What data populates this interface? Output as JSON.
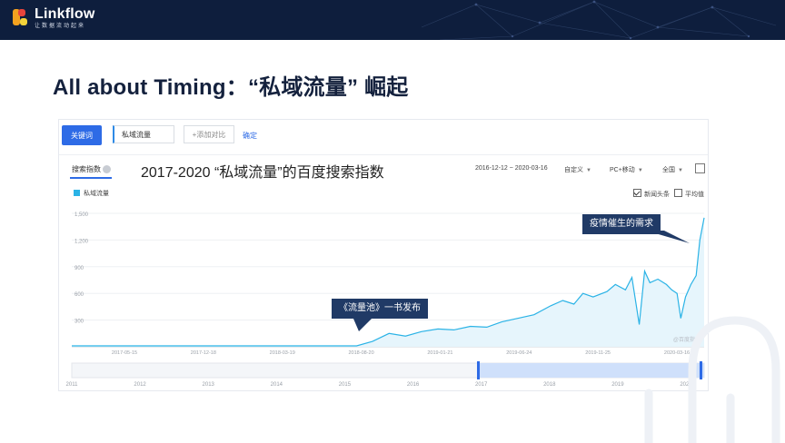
{
  "brand": {
    "name": "Linkflow",
    "tagline": "让数据流动起来"
  },
  "page": {
    "title": "All about Timing：“私域流量” 崛起"
  },
  "toolbar": {
    "keyword_button": "关键词",
    "keyword_value": "私域流量",
    "add_compare": "+添加对比",
    "confirm": "确定"
  },
  "tabs": {
    "active": "搜索指数"
  },
  "chart_title": "2017-2020 “私域流量”的百度搜索指数",
  "controls": {
    "date_range": "2016-12-12 ~ 2020-03-16",
    "custom": "自定义",
    "device": "PC+移动",
    "region": "全国"
  },
  "legend": {
    "series": "私域流量"
  },
  "options": {
    "news": "新闻头条",
    "news_checked": true,
    "average": "平均值",
    "average_checked": false
  },
  "watermark": "@百度指数",
  "callouts": {
    "book": "《流量池》一书发布",
    "pandemic": "疫情催生的需求"
  },
  "colors": {
    "accent": "#2e6be6",
    "line": "#2bb3e6",
    "callout": "#203a66",
    "header": "#0e1e3d"
  },
  "chart_data": {
    "type": "line",
    "ylabel_ticks": [
      "1,500",
      "1,200",
      "900",
      "600",
      "300"
    ],
    "yticks": [
      1500,
      1200,
      900,
      600,
      300
    ],
    "ylim": [
      0,
      1500
    ],
    "x_ticks": [
      "2017-05-15",
      "2017-12-18",
      "2018-03-19",
      "2018-08-20",
      "2019-01-21",
      "2019-06-24",
      "2019-11-25",
      "2020-03-16"
    ],
    "x": [
      "2016-12-12",
      "2017-03-01",
      "2017-06-01",
      "2017-09-01",
      "2017-12-01",
      "2018-03-01",
      "2018-06-01",
      "2018-07-01",
      "2018-08-01",
      "2018-09-01",
      "2018-10-01",
      "2018-11-01",
      "2018-12-01",
      "2019-01-01",
      "2019-02-01",
      "2019-03-01",
      "2019-04-01",
      "2019-05-01",
      "2019-06-01",
      "2019-06-24",
      "2019-07-15",
      "2019-08-01",
      "2019-08-20",
      "2019-09-15",
      "2019-10-01",
      "2019-10-20",
      "2019-11-01",
      "2019-11-15",
      "2019-11-25",
      "2019-12-05",
      "2019-12-20",
      "2020-01-05",
      "2020-01-15",
      "2020-01-25",
      "2020-02-01",
      "2020-02-10",
      "2020-02-20",
      "2020-03-01",
      "2020-03-08",
      "2020-03-16"
    ],
    "y": [
      10,
      10,
      10,
      10,
      10,
      10,
      10,
      60,
      150,
      120,
      170,
      200,
      190,
      230,
      220,
      280,
      320,
      360,
      460,
      520,
      480,
      600,
      560,
      620,
      700,
      640,
      780,
      250,
      850,
      720,
      760,
      700,
      640,
      600,
      320,
      560,
      700,
      800,
      1200,
      1450
    ],
    "brush_years": [
      "2011",
      "2012",
      "2013",
      "2014",
      "2015",
      "2016",
      "2017",
      "2018",
      "2019",
      "2020"
    ],
    "grid": true
  }
}
